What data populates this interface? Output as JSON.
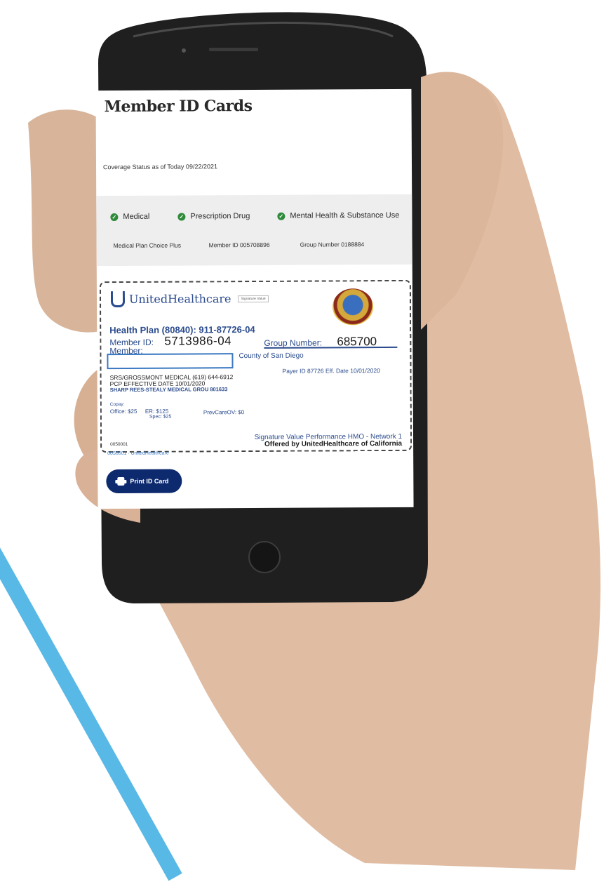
{
  "screen": {
    "title": "Member ID Cards",
    "coverage_status": "Coverage Status as of Today 09/22/2021",
    "coverage_items": [
      "Medical",
      "Prescription Drug",
      "Mental Health & Substance Use"
    ],
    "plan_info": {
      "plan": "Medical Plan Choice Plus",
      "member": "Member ID 005708896",
      "group": "Group Number 0188884"
    },
    "card": {
      "brand": "UnitedHealthcare",
      "brand_tag": "Signature Value",
      "health_plan": "Health Plan (80840): 911-87726-04",
      "member_id_label": "Member ID:",
      "member_id": "5713986-04",
      "group_label": "Group Number:",
      "group_number": "685700",
      "member_label": "Member:",
      "county": "County of San Diego",
      "payer": "Payer ID 87726 Eff. Date 10/01/2020",
      "pcp_line1": "SRS/GROSSMONT MEDICAL (619) 644-6912",
      "pcp_line2": "PCP EFFECTIVE DATE 10/01/2020",
      "pcp_line3": "SHARP REES-STEALY MEDICAL GROU 801633",
      "copay_label": "Copay:",
      "office": "Office: $25",
      "er": "ER: $125",
      "spec": "Spec: $25",
      "prev": "PrevCareOV: $0",
      "plan_name": "Signature Value Performance HMO - Network 1",
      "offered_by": "Offered by UnitedHealthcare of California",
      "code": "0050001",
      "below_text": "0050001 · UnitedHealthcare"
    },
    "print_button": "Print ID Card"
  },
  "colors": {
    "accent_blue": "#2a4b8d",
    "button_navy": "#0e2a6e",
    "check_green": "#2e8b3a",
    "decor_line": "#58b8e6"
  }
}
